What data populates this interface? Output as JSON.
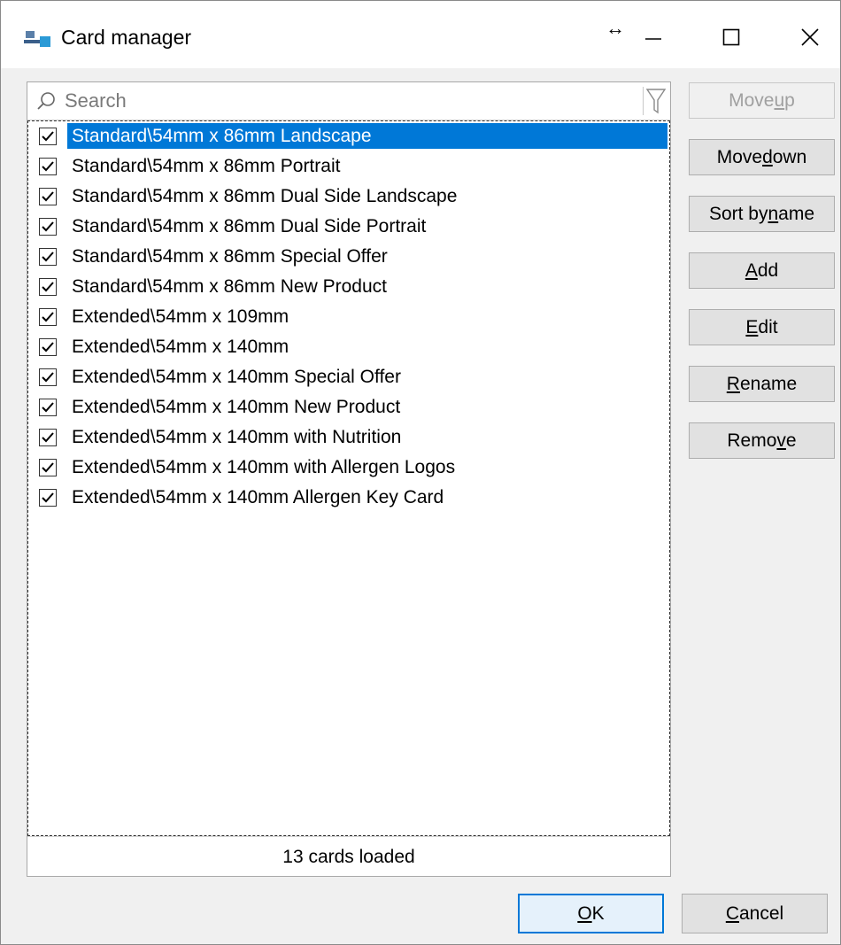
{
  "window": {
    "title": "Card manager",
    "resize_glyph": "↔"
  },
  "search": {
    "placeholder": "Search",
    "value": ""
  },
  "cards": [
    {
      "label": "Standard\\54mm x 86mm Landscape",
      "checked": true,
      "selected": true
    },
    {
      "label": "Standard\\54mm x 86mm Portrait",
      "checked": true
    },
    {
      "label": "Standard\\54mm x 86mm Dual Side Landscape",
      "checked": true
    },
    {
      "label": "Standard\\54mm x 86mm Dual Side Portrait",
      "checked": true
    },
    {
      "label": "Standard\\54mm x 86mm Special Offer",
      "checked": true
    },
    {
      "label": "Standard\\54mm x 86mm New Product",
      "checked": true
    },
    {
      "label": "Extended\\54mm x 109mm",
      "checked": true
    },
    {
      "label": "Extended\\54mm x 140mm",
      "checked": true
    },
    {
      "label": "Extended\\54mm x 140mm Special Offer",
      "checked": true
    },
    {
      "label": "Extended\\54mm x 140mm New Product",
      "checked": true
    },
    {
      "label": "Extended\\54mm x 140mm with Nutrition",
      "checked": true
    },
    {
      "label": "Extended\\54mm x 140mm with Allergen Logos",
      "checked": true
    },
    {
      "label": "Extended\\54mm x 140mm Allergen Key Card",
      "checked": true
    }
  ],
  "status": "13 cards loaded",
  "buttons": {
    "move_up": {
      "pre": "Move ",
      "key": "u",
      "post": "p",
      "enabled": false
    },
    "move_down": {
      "pre": "Move ",
      "key": "d",
      "post": "own",
      "enabled": true
    },
    "sort_by_name": {
      "pre": "Sort by ",
      "key": "n",
      "post": "ame",
      "enabled": true
    },
    "add": {
      "pre": "",
      "key": "A",
      "post": "dd",
      "enabled": true
    },
    "edit": {
      "pre": "",
      "key": "E",
      "post": "dit",
      "enabled": true
    },
    "rename": {
      "pre": "",
      "key": "R",
      "post": "ename",
      "enabled": true
    },
    "remove": {
      "pre": "Remo",
      "key": "v",
      "post": "e",
      "enabled": true
    },
    "ok": {
      "pre": "",
      "key": "O",
      "post": "K"
    },
    "cancel": {
      "pre": "",
      "key": "C",
      "post": "ancel"
    }
  },
  "colors": {
    "selection": "#0078d7",
    "dialog_bg": "#f0f0f0",
    "button_bg": "#e1e1e1"
  },
  "icons": {
    "app": "card-manager-app-icon",
    "search": "magnifier-icon",
    "filter": "funnel-icon",
    "minimize": "minimize-icon",
    "maximize": "maximize-icon",
    "close": "close-icon"
  }
}
